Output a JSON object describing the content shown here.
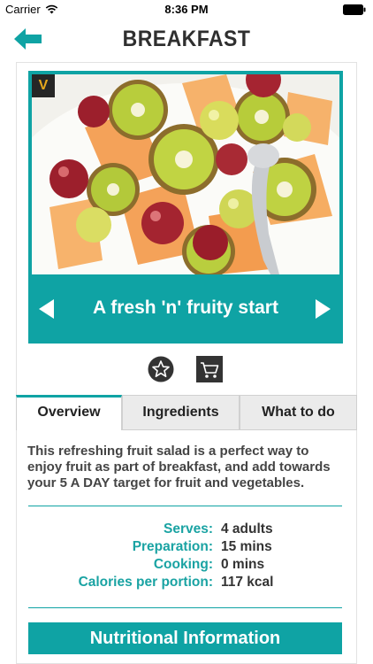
{
  "status_bar": {
    "carrier": "Carrier",
    "time": "8:36 PM"
  },
  "header": {
    "title": "BREAKFAST"
  },
  "recipe": {
    "badge": "V",
    "title": "A fresh 'n' fruity start",
    "description": "This refreshing fruit salad is a perfect way to enjoy fruit as part of breakfast, and add towards your 5 A DAY target for fruit and vegetables."
  },
  "tabs": [
    {
      "label": "Overview",
      "active": true
    },
    {
      "label": "Ingredients",
      "active": false
    },
    {
      "label": "What to do",
      "active": false
    }
  ],
  "facts": [
    {
      "label": "Serves:",
      "value": "4  adults"
    },
    {
      "label": "Preparation:",
      "value": "15  mins"
    },
    {
      "label": "Cooking:",
      "value": "0  mins"
    },
    {
      "label": "Calories per portion:",
      "value": "117  kcal"
    }
  ],
  "nutrition_button": "Nutritional Information",
  "colors": {
    "accent": "#0fa3a4",
    "badge_bg": "#262626",
    "badge_text": "#e8a81c"
  },
  "icons": [
    "wifi-icon",
    "battery-icon",
    "back-arrow-icon",
    "chevron-left-icon",
    "chevron-right-icon",
    "star-icon",
    "cart-icon"
  ]
}
